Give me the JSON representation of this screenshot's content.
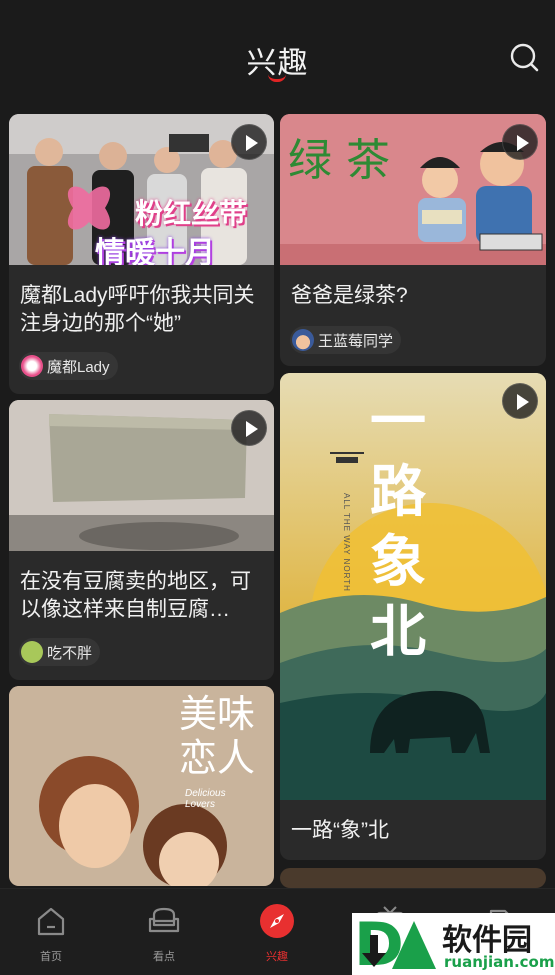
{
  "header": {
    "title": "兴趣"
  },
  "cards": [
    {
      "title": "魔都Lady呼吁你我共同关注身边的那个“她”",
      "author": "魔都Lady",
      "overlay_text_1": "粉红丝带",
      "overlay_text_2": "情暖十月"
    },
    {
      "title": "爸爸是绿茶?",
      "author": "王蓝莓同学",
      "overlay_text": "绿 茶"
    },
    {
      "title": "在没有豆腐卖的地区，可以像这样来自制豆腐…",
      "author": "吃不胖"
    },
    {
      "title": "一路“象”北",
      "overlay_text": "一路象北",
      "overlay_subtitle": "ALL THE WAY NORTH"
    },
    {
      "overlay_text": "美味恋人",
      "overlay_subtitle": "Delicious Lovers"
    }
  ],
  "bottom_nav": {
    "items": [
      {
        "label": "首页",
        "icon": "home-icon"
      },
      {
        "label": "看点",
        "icon": "sofa-icon"
      },
      {
        "label": "兴趣",
        "icon": "compass-icon",
        "active": true
      },
      {
        "label": "",
        "icon": "tv-icon"
      },
      {
        "label": "",
        "icon": "tag-icon"
      }
    ]
  },
  "watermark": {
    "brand": "软件园",
    "domain": "ruanjian.com",
    "logo": "DA"
  },
  "colors": {
    "accent": "#e83030",
    "background": "#1b1b1b",
    "card": "#2a2a2a"
  }
}
